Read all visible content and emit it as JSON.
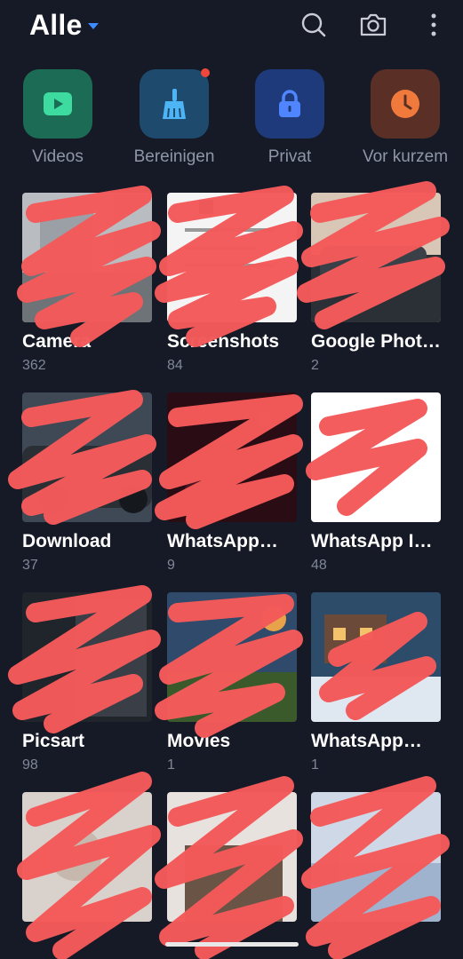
{
  "header": {
    "title": "Alle",
    "icons": [
      "search-icon",
      "camera-icon",
      "more-vertical-icon"
    ]
  },
  "quick_actions": [
    {
      "label": "Videos",
      "icon": "play-icon",
      "color": "#1b6b55"
    },
    {
      "label": "Bereinigen",
      "icon": "broom-icon",
      "color": "#1e4a6e",
      "badge": true
    },
    {
      "label": "Privat",
      "icon": "lock-icon",
      "color": "#1f3a7a"
    },
    {
      "label": "Vor kurzem",
      "icon": "clock-icon",
      "color": "#5a2f26"
    }
  ],
  "albums": [
    {
      "name": "Camera",
      "count": "362"
    },
    {
      "name": "Screenshots",
      "count": "84"
    },
    {
      "name": "Google Phot…",
      "count": "2"
    },
    {
      "name": "Download",
      "count": "37"
    },
    {
      "name": "WhatsApp…",
      "count": "9"
    },
    {
      "name": "WhatsApp I…",
      "count": "48"
    },
    {
      "name": "Picsart",
      "count": "98"
    },
    {
      "name": "Movies",
      "count": "1"
    },
    {
      "name": "WhatsApp…",
      "count": "1"
    },
    {
      "name": "",
      "count": ""
    },
    {
      "name": "",
      "count": ""
    },
    {
      "name": "",
      "count": ""
    }
  ],
  "colors": {
    "background": "#161a26",
    "accent": "#3c8cff",
    "redaction": "#f45a5a"
  }
}
